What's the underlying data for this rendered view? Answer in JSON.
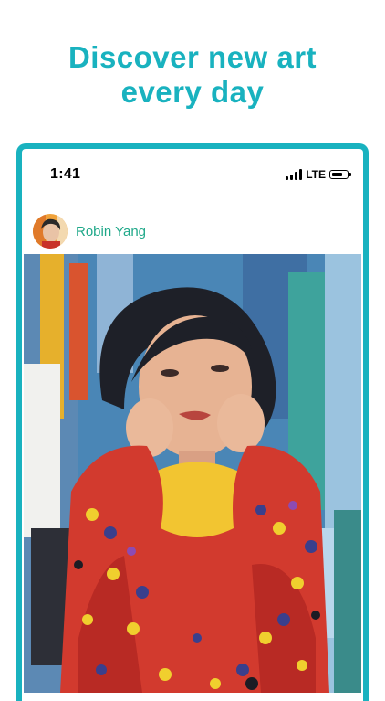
{
  "headline": {
    "line1": "Discover new art",
    "line2": "every day"
  },
  "status_bar": {
    "time": "1:41",
    "network": "LTE"
  },
  "post": {
    "author_name": "Robin Yang"
  },
  "colors": {
    "accent": "#19b2bf",
    "author": "#1fa889"
  },
  "icons": [
    "signal-icon",
    "battery-icon"
  ]
}
